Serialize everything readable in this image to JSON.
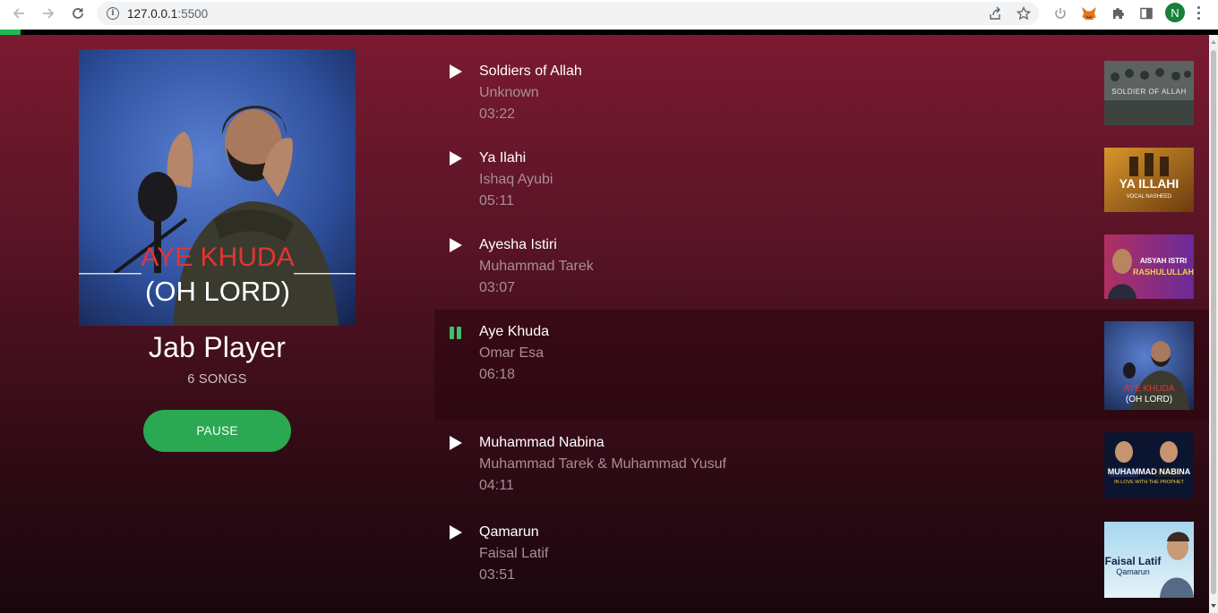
{
  "browser": {
    "url_host": "127.0.0.1",
    "url_port": ":5500",
    "profile_initial": "N",
    "icons": [
      "back-arrow-icon",
      "forward-arrow-icon",
      "reload-icon",
      "info-icon",
      "share-icon",
      "bookmark-star-icon",
      "power-icon",
      "metamask-fox-icon",
      "puzzle-extensions-icon",
      "side-panel-icon",
      "kebab-menu-icon"
    ]
  },
  "progress": {
    "fraction": 0.017,
    "color": "#1db954"
  },
  "player": {
    "title": "Jab Player",
    "song_count": "6 SONGS",
    "pause_label": "PAUSE",
    "cover": {
      "line1": "AYE KHUDA",
      "line2": "(OH LORD)"
    }
  },
  "songs": [
    {
      "title": "Soldiers of Allah",
      "artist": "Unknown",
      "duration": "03:22",
      "state": "play",
      "thumb_text": "SOLDIER OF ALLAH"
    },
    {
      "title": "Ya Ilahi",
      "artist": "Ishaq Ayubi",
      "duration": "05:11",
      "state": "play",
      "thumb_text": "YA ILLAHI",
      "thumb_sub": "VOCAL NASHEED"
    },
    {
      "title": "Ayesha Istiri",
      "artist": "Muhammad Tarek",
      "duration": "03:07",
      "state": "play",
      "thumb_text": "AISYAH ISTRI",
      "thumb_sub": "RASHULULLAH"
    },
    {
      "title": "Aye Khuda",
      "artist": "Omar Esa",
      "duration": "06:18",
      "state": "pause",
      "active": true,
      "thumb_text": "AYE KHUDA",
      "thumb_sub": "(OH LORD)"
    },
    {
      "title": "Muhammad Nabina",
      "artist": "Muhammad Tarek & Muhammad Yusuf",
      "duration": "04:11",
      "state": "play",
      "thumb_text": "MUHAMMAD NABINA",
      "thumb_sub": "IN LOVE WITH THE PROPHET"
    },
    {
      "title": "Qamarun",
      "artist": "Faisal Latif",
      "duration": "03:51",
      "state": "play",
      "thumb_text": "Faisal Latif",
      "thumb_sub": "Qamarun"
    }
  ],
  "colors": {
    "accent": "#2aa952",
    "playing_icon": "#3cc06a"
  }
}
